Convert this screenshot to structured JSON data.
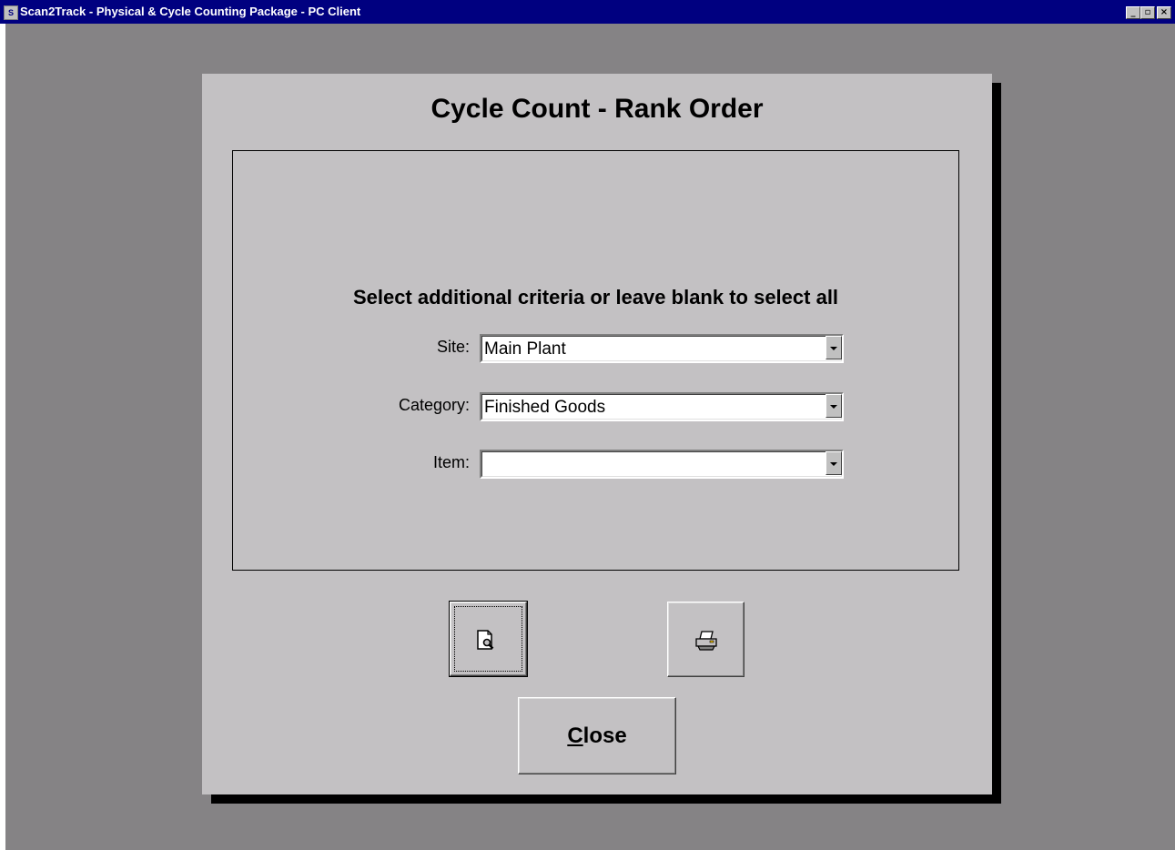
{
  "window": {
    "title": "Scan2Track - Physical & Cycle Counting Package - PC Client",
    "controls": [
      "minimize-icon",
      "maximize-icon",
      "close-icon"
    ]
  },
  "form": {
    "title": "Cycle Count - Rank Order",
    "criteria_heading": "Select additional criteria or leave blank to select all",
    "fields": [
      {
        "label": "Site:",
        "value": "Main Plant"
      },
      {
        "label": "Category:",
        "value": "Finished Goods"
      },
      {
        "label": "Item:",
        "value": ""
      }
    ],
    "buttons": {
      "preview_icon": "print-preview-icon",
      "print_icon": "printer-icon",
      "close_label_mnemonic": "C",
      "close_label_rest": "lose"
    }
  }
}
